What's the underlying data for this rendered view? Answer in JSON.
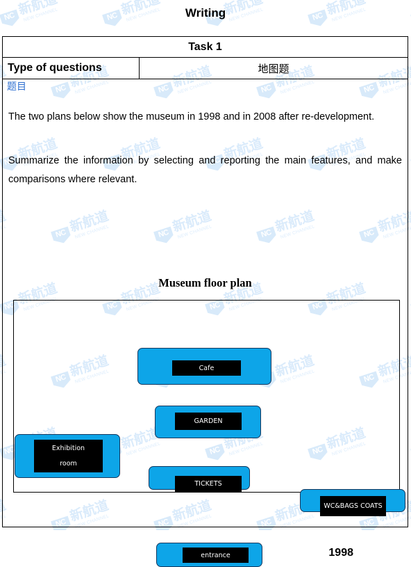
{
  "page": {
    "title": "Writing"
  },
  "table": {
    "task_row_label": "Task 1",
    "type_key": "Type of questions",
    "type_value": "地图题",
    "section_heading": "题目"
  },
  "prompt": {
    "paragraphs": [
      "The two plans below show the museum in 1998 and in 2008 after re-development.",
      "Summarize the information by selecting and reporting the main features, and make comparisons where relevant."
    ]
  },
  "diagram": {
    "title": "Museum floor plan",
    "year": "1998",
    "rooms": [
      {
        "name": "cafe",
        "label": "Cafe"
      },
      {
        "name": "garden",
        "label": "GARDEN"
      },
      {
        "name": "exhibition-room",
        "label": "Exhibition\nroom"
      },
      {
        "name": "tickets",
        "label": "TICKETS"
      },
      {
        "name": "wc-bags-coats",
        "label": "WC&BAGS COATS"
      },
      {
        "name": "entrance",
        "label": "entrance"
      }
    ]
  },
  "colors": {
    "room_fill": "#0DA5E8",
    "room_border": "#14375E",
    "label_fill": "#000000",
    "label_text": "#FFFFFF",
    "heading_blue": "#2E6FD0",
    "watermark": "#D9EAFB"
  },
  "watermark": {
    "badge_text": "NC",
    "cn_text": "新航道",
    "en_text": "NEW CHANNEL"
  }
}
